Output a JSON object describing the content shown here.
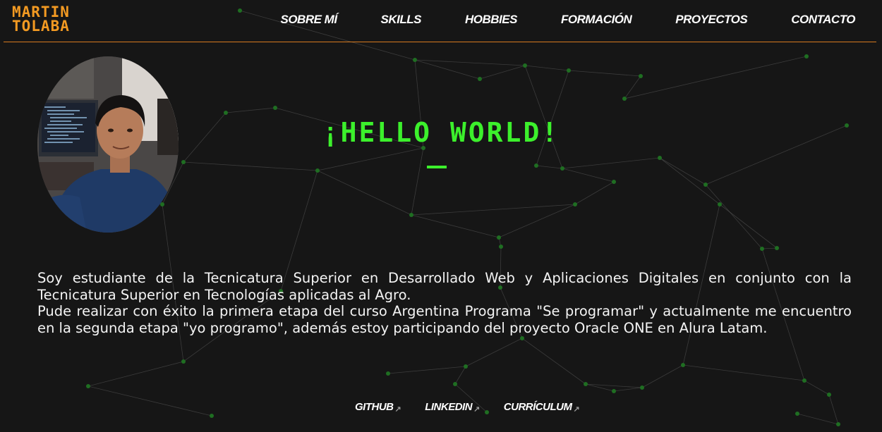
{
  "header": {
    "logo_line1": "MARTIN",
    "logo_line2": "TOLABA",
    "nav": [
      "SOBRE MÍ",
      "SKILLS",
      "HOBBIES",
      "FORMACIÓN",
      "PROYECTOS",
      "CONTACTO"
    ]
  },
  "hero": {
    "title": "¡HELLO WORLD!"
  },
  "bio": {
    "paragraph1": "Soy estudiante de la Tecnicatura Superior en Desarrollado Web y Aplicaciones Digitales en conjunto con la Tecnicatura Superior en Tecnologías aplicadas al Agro.",
    "paragraph2": "Pude realizar con éxito la primera etapa del curso Argentina Programa \"Se programar\" y actualmente me encuentro en la segunda etapa \"yo programo\", además estoy participando del proyecto Oracle ONE en Alura Latam."
  },
  "links": [
    "GITHUB",
    "LINKEDIN",
    "CURRÍCULUM"
  ],
  "colors": {
    "accent_orange": "#f39a22",
    "accent_green": "#3cf02c",
    "background": "#161616",
    "network_lines": "#5a5a5a",
    "network_nodes": "#1f6e22"
  },
  "icons": {
    "external_link": "external-link-arrow-icon"
  }
}
